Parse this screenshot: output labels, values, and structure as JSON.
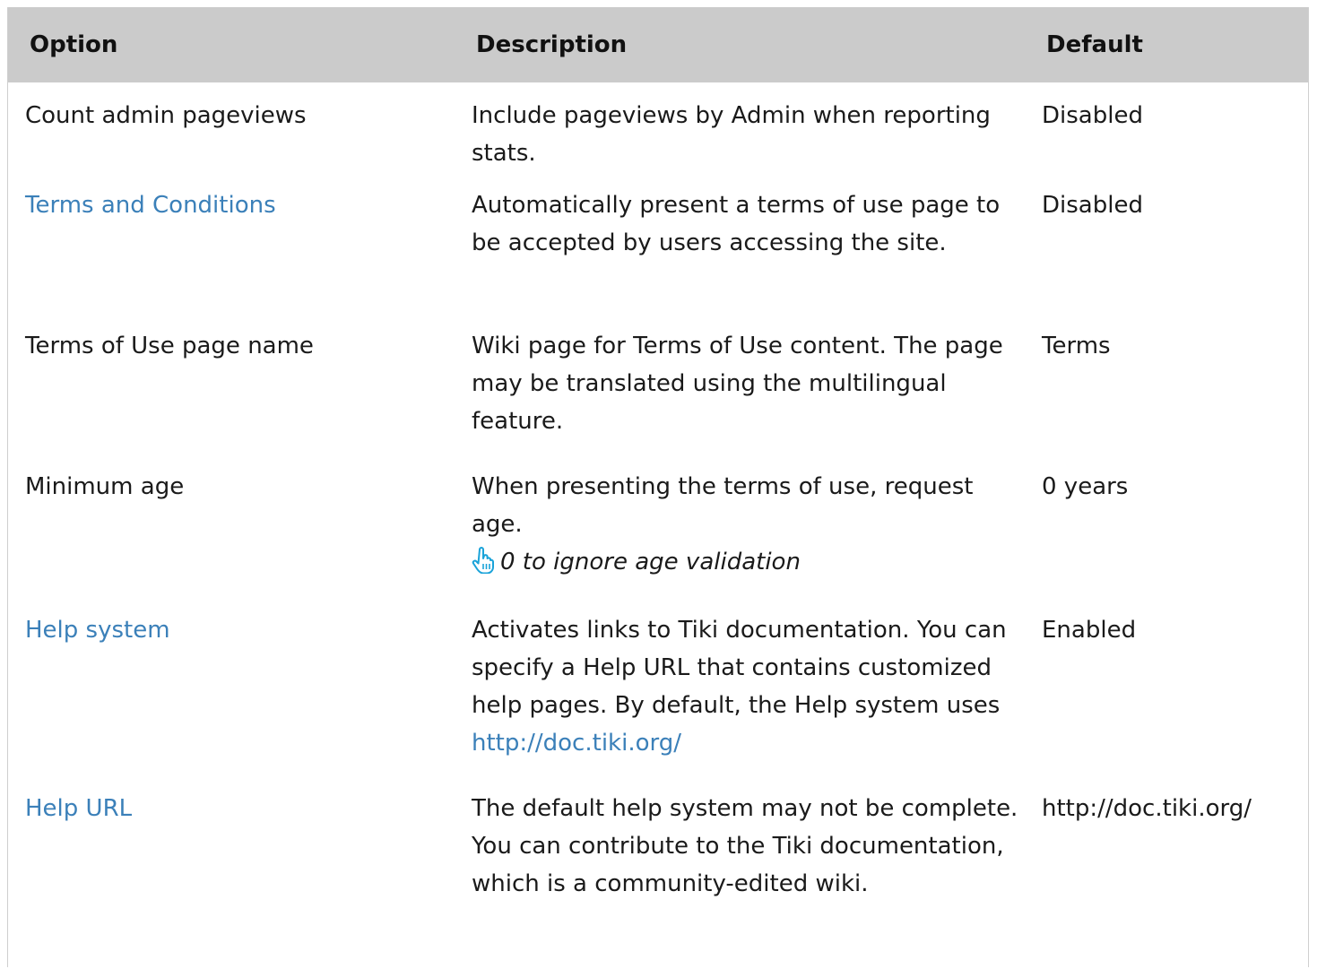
{
  "table": {
    "headers": {
      "option": "Option",
      "description": "Description",
      "default": "Default"
    },
    "rows": [
      {
        "option": "Count admin pageviews",
        "option_is_link": false,
        "description": "Include pageviews by Admin when reporting stats.",
        "default": "Disabled"
      },
      {
        "option": "Terms and Conditions",
        "option_is_link": true,
        "description": "Automatically present a terms of use page to be accepted by users accessing the site.",
        "default": "Disabled"
      },
      {
        "option": "Terms of Use page name",
        "option_is_link": false,
        "description": "Wiki page for Terms of Use content. The page may be translated using the multilingual feature.",
        "default": "Terms"
      },
      {
        "option": "Minimum age",
        "option_is_link": false,
        "description": "When presenting the terms of use, request age.",
        "tip": "0 to ignore age validation",
        "tip_icon": "pointing-hand-icon",
        "default": "0 years"
      },
      {
        "option": "Help system",
        "option_is_link": true,
        "description": "Activates links to Tiki documentation. You can specify a Help URL that contains customized help pages. By default, the Help system uses",
        "description_link": "http://doc.tiki.org/",
        "default": "Enabled"
      },
      {
        "option": "Help URL",
        "option_is_link": true,
        "description": "The default help system may not be complete. You can contribute to the Tiki documentation, which is a community-edited wiki.",
        "default": "http://doc.tiki.org/"
      }
    ]
  },
  "colors": {
    "header_bg": "#cbcbcb",
    "link": "#3b80b9",
    "tip_icon": "#1aa3d9"
  }
}
